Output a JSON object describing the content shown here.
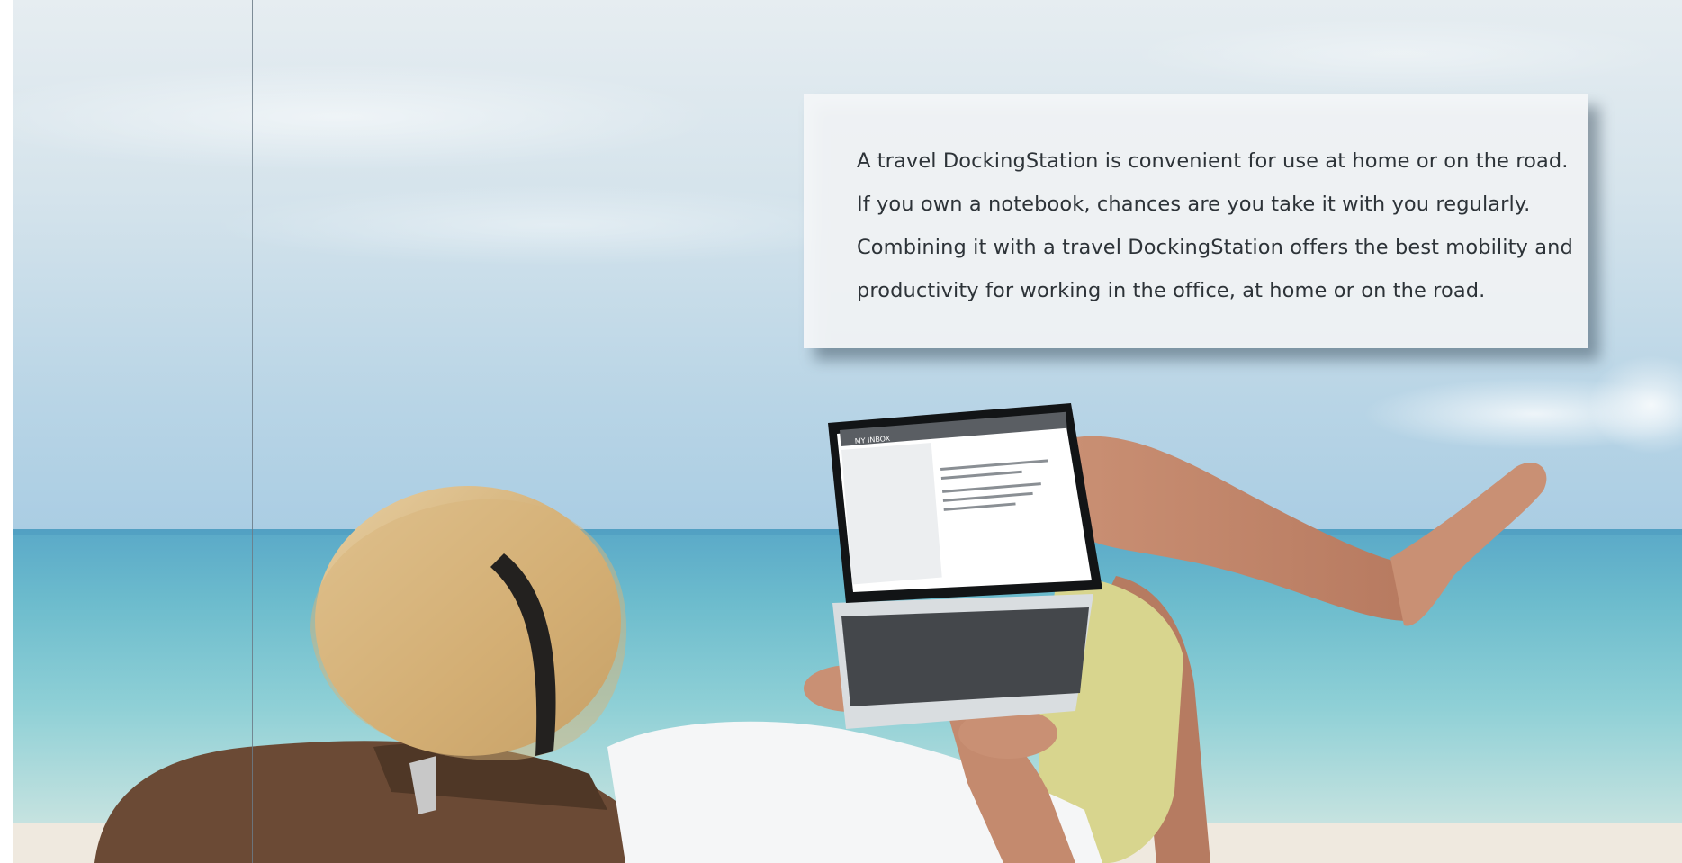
{
  "callout": {
    "lines": [
      "A travel DockingStation is convenient for use at home or on the road.",
      "If you own a notebook, chances are you take it with you regularly.",
      "Combining it with a travel DockingStation offers the best mobility and",
      "productivity for working in the office, at home or on the road."
    ]
  },
  "photo": {
    "subject": "man-in-straw-hat-using-laptop-on-beach",
    "colors": {
      "sky": "#dfe8ee",
      "sea": "#7ec7cf",
      "sand": "#f1ede6",
      "callout_text": "#2d3338"
    }
  },
  "laptop_screen": {
    "app_title": "MY INBOX"
  }
}
